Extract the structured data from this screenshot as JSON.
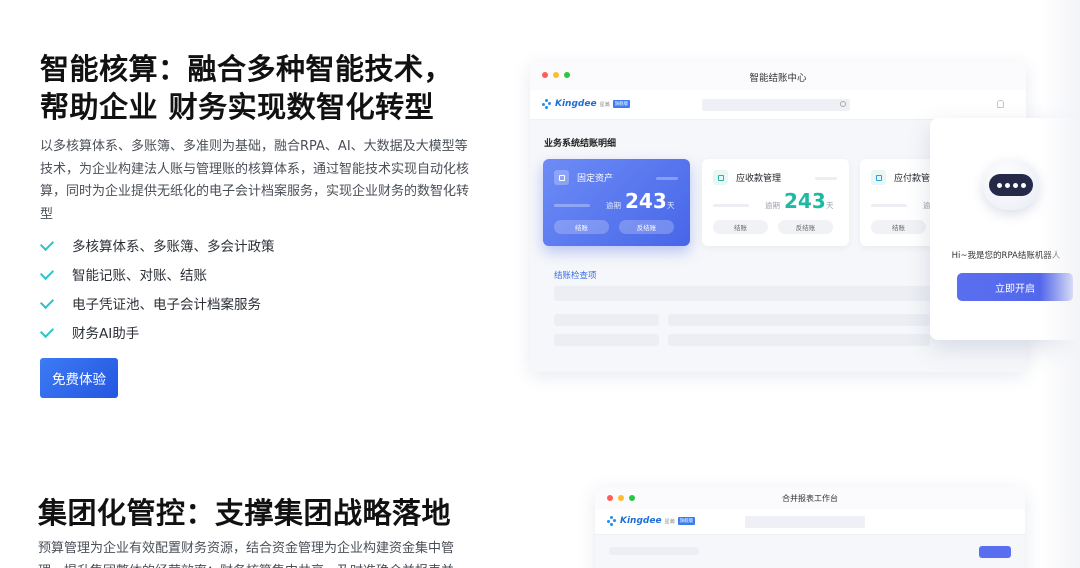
{
  "section1": {
    "title": "智能核算：融合多种智能技术，帮助企业 财务实现数智化转型",
    "description": "以多核算体系、多账簿、多准则为基础，融合RPA、AI、大数据及大模型等技术，为企业构建法人账与管理账的核算体系，通过智能技术实现自动化核算，同时为企业提供无纸化的电子会计档案服务，实现企业财务的数智化转型",
    "features": [
      "多核算体系、多账簿、多会计政策",
      "智能记账、对账、结账",
      "电子凭证池、电子会计档案服务",
      "财务AI助手"
    ],
    "cta_label": "免费体验"
  },
  "window1": {
    "title": "智能结账中心",
    "logo": {
      "brand": "Kingdee",
      "sub": "星瀚",
      "badge": "旗舰版"
    },
    "section_label": "业务系统结账明细",
    "cards": [
      {
        "title": "固定资产",
        "label": "逾期",
        "value": "243",
        "unit": "天",
        "btn_left": "结账",
        "btn_right": "反结账"
      },
      {
        "title": "应收款管理",
        "label": "逾期",
        "value": "243",
        "unit": "天",
        "btn_left": "结账",
        "btn_right": "反结账"
      },
      {
        "title": "应付款管",
        "label": "逾",
        "btn_left": "结账"
      }
    ],
    "check_title": "结账检查项"
  },
  "popup": {
    "message": "Hi~我是您的RPA结账机器人",
    "button": "立即开启"
  },
  "section2": {
    "title": "集团化管控：支撑集团战略落地",
    "description": "预算管理为企业有效配置财务资源，结合资金管理为企业构建资金集中管理，提升集团整体的经营效率；财务核算集中共享，及时准确合并报表并"
  },
  "window2": {
    "title": "合并报表工作台",
    "logo": {
      "brand": "Kingdee",
      "sub": "星瀚",
      "badge": "旗舰版"
    }
  },
  "colors": {
    "primary": "#2456e0",
    "check": "#2ec4c8",
    "teal_value": "#20b8a4",
    "card_blue": "#4766e8"
  }
}
